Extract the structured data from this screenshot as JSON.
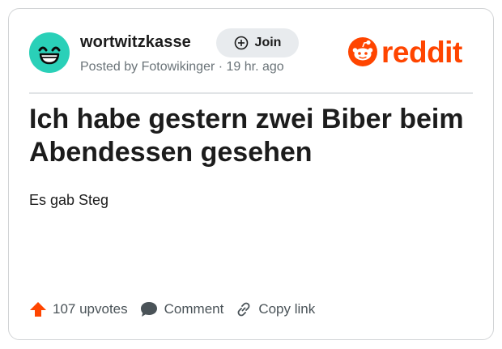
{
  "post": {
    "subreddit": "wortwitzkasse",
    "join_label": "Join",
    "meta": "Posted by Fotowikinger · 19 hr. ago",
    "title": "Ich habe gestern zwei Biber beim Abendessen gesehen",
    "body": "Es gab Steg"
  },
  "brand": {
    "wordmark": "reddit",
    "color": "#ff4500"
  },
  "actions": {
    "upvotes_label": "107 upvotes",
    "comment_label": "Comment",
    "copy_link_label": "Copy link"
  },
  "icons": {
    "avatar": "grinning-face-icon",
    "join": "plus-circle-icon",
    "brand": "reddit-snoo-icon",
    "upvote": "upvote-arrow-icon",
    "comment": "speech-bubble-icon",
    "copy_link": "link-icon"
  },
  "colors": {
    "avatar_bg": "#2ad0b8",
    "upvote": "#ff4500",
    "text": "#1c1c1c",
    "muted": "#6a7378"
  }
}
